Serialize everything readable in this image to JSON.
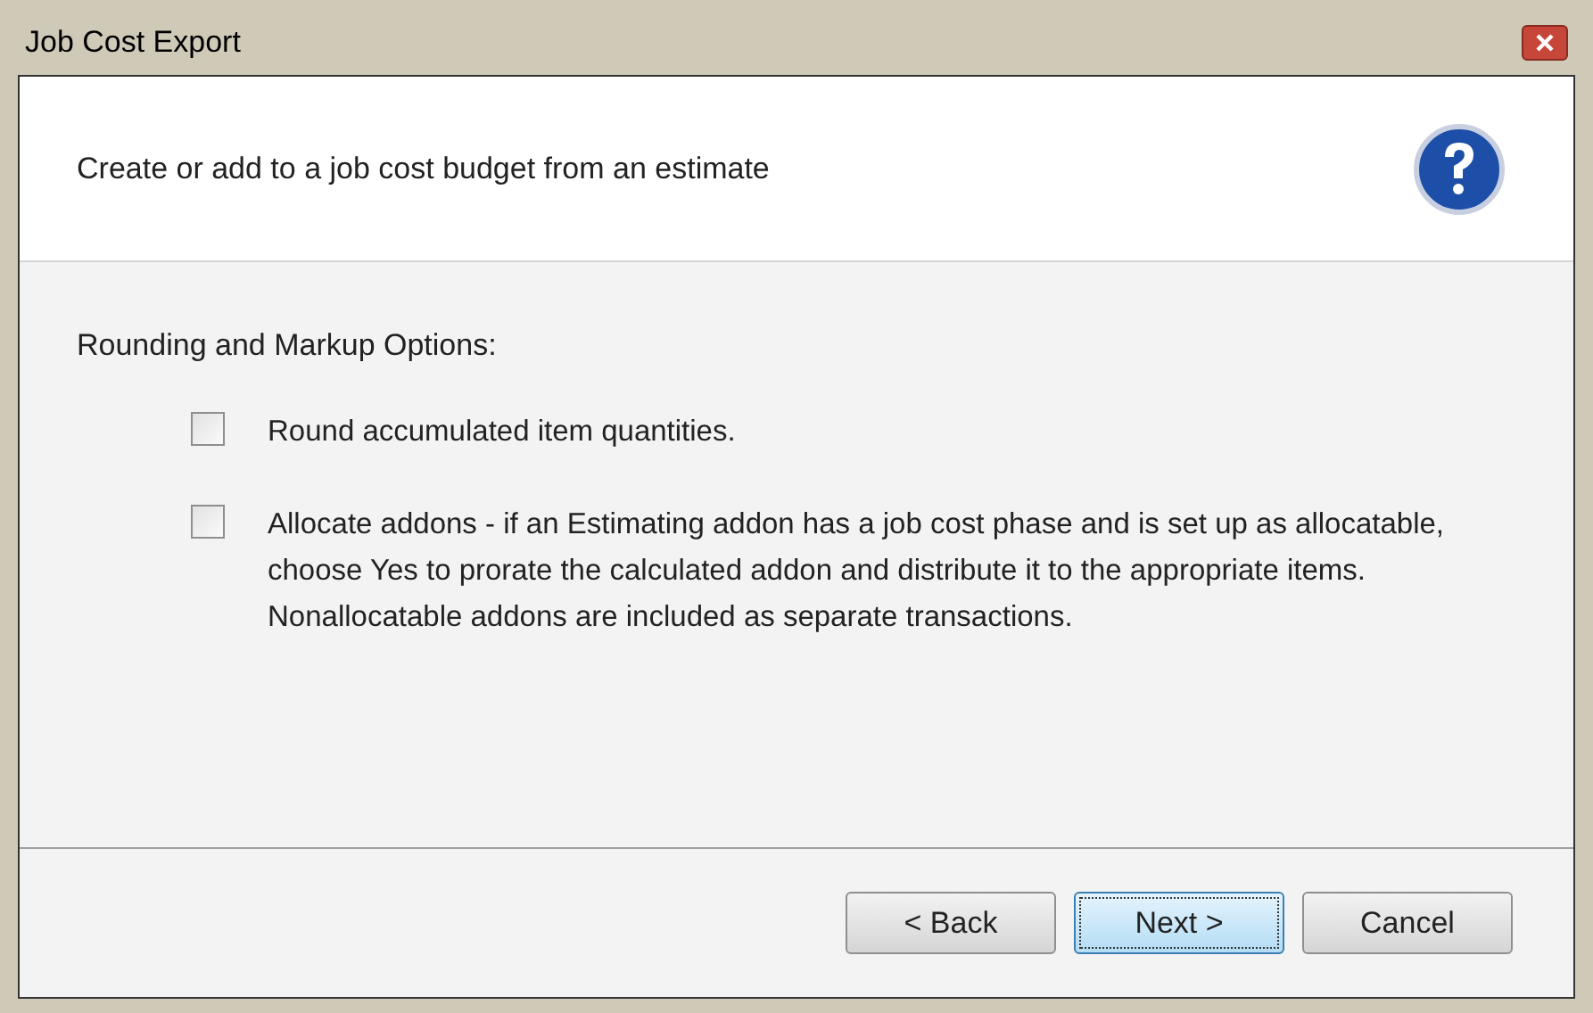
{
  "window": {
    "title": "Job Cost Export"
  },
  "header": {
    "text": "Create or add to a job cost budget from an estimate"
  },
  "section": {
    "title": "Rounding and Markup Options:"
  },
  "options": [
    {
      "label": "Round accumulated item quantities.",
      "checked": false
    },
    {
      "label": "Allocate addons - if an Estimating addon has a job cost phase and is set up as allocatable, choose Yes to prorate the calculated addon and distribute it to the appropriate items.  Nonallocatable addons are included as separate transactions.",
      "checked": false
    }
  ],
  "buttons": [
    {
      "label": "< Back",
      "focused": false
    },
    {
      "label": "Next >",
      "focused": true
    },
    {
      "label": "Cancel",
      "focused": false
    }
  ]
}
